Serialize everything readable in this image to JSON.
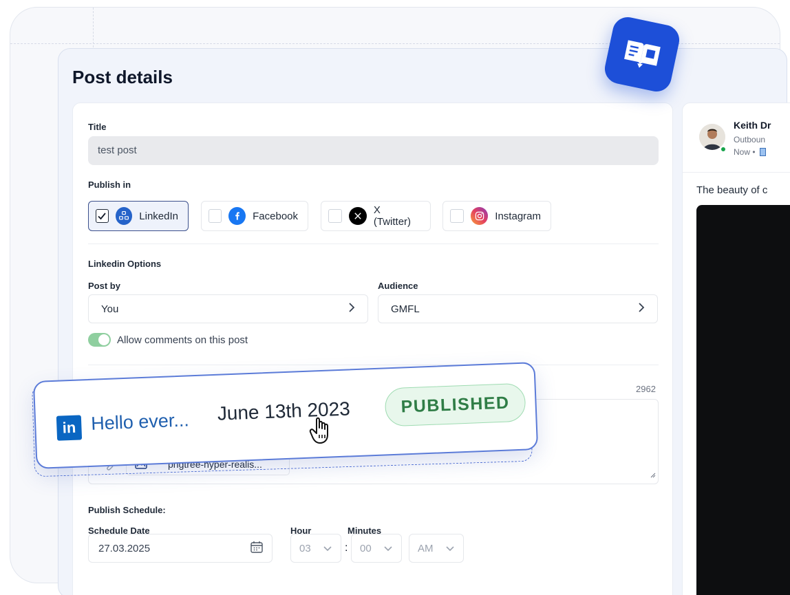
{
  "page": {
    "title": "Post details"
  },
  "form": {
    "title_label": "Title",
    "title_value": "test post",
    "publish_in_label": "Publish in",
    "platforms": [
      {
        "label": "LinkedIn",
        "checked": true
      },
      {
        "label": "Facebook",
        "checked": false
      },
      {
        "label": "X (Twitter)",
        "checked": false
      },
      {
        "label": "Instagram",
        "checked": false
      }
    ],
    "linkedin_options_label": "Linkedin Options",
    "post_by_label": "Post by",
    "post_by_value": "You",
    "audience_label": "Audience",
    "audience_value": "GMFL",
    "allow_comments_label": "Allow comments on this post",
    "allow_comments_on": true,
    "char_count": "2962",
    "attachment_name": "pngtree-hyper-realis...",
    "publish_schedule_label": "Publish Schedule:",
    "schedule_date_label": "Schedule Date",
    "schedule_date_value": "27.03.2025",
    "hour_label": "Hour",
    "minutes_label": "Minutes",
    "hour_value": "03",
    "minutes_value": "00",
    "ampm_value": "AM"
  },
  "preview": {
    "name": "Keith Dr",
    "subtitle": "Outboun",
    "meta": "Now •",
    "text": "The beauty of c"
  },
  "notification": {
    "title": "Hello ever...",
    "date": "June 13th 2023",
    "status": "PUBLISHED"
  },
  "colors": {
    "accent": "#1d4fd8",
    "linkedin": "#0a66c2",
    "status_green": "#2f7d46",
    "toggle_on": "#8fcf9f"
  }
}
